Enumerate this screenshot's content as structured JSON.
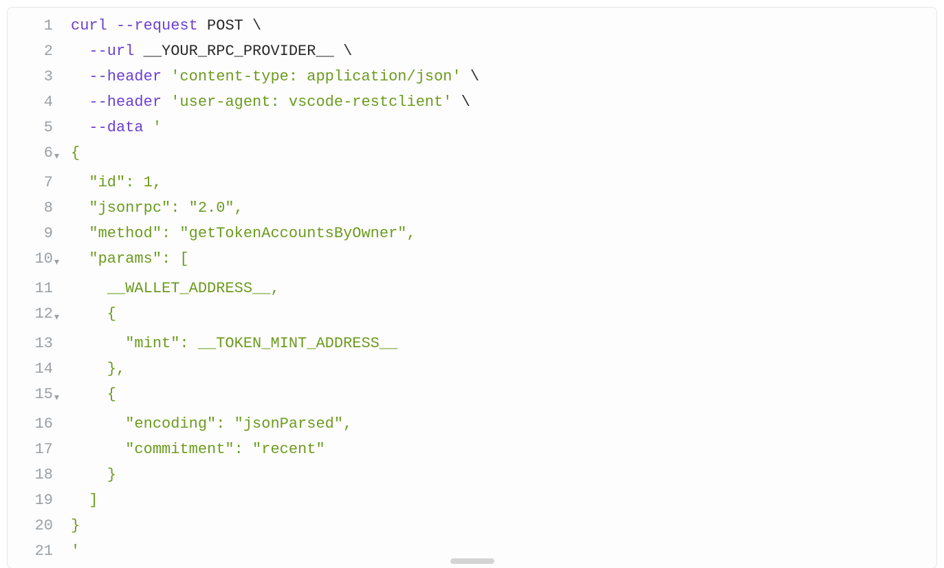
{
  "lines": [
    {
      "n": 1,
      "fold": false,
      "tokens": [
        {
          "cls": "tok-cmd",
          "t": "curl"
        },
        {
          "cls": "tok-plain",
          "t": " "
        },
        {
          "cls": "tok-cmd",
          "t": "--request"
        },
        {
          "cls": "tok-plain",
          "t": " POST \\"
        }
      ]
    },
    {
      "n": 2,
      "fold": false,
      "tokens": [
        {
          "cls": "tok-plain",
          "t": "  "
        },
        {
          "cls": "tok-cmd",
          "t": "--url"
        },
        {
          "cls": "tok-plain",
          "t": " __YOUR_RPC_PROVIDER__ \\"
        }
      ]
    },
    {
      "n": 3,
      "fold": false,
      "tokens": [
        {
          "cls": "tok-plain",
          "t": "  "
        },
        {
          "cls": "tok-cmd",
          "t": "--header"
        },
        {
          "cls": "tok-plain",
          "t": " "
        },
        {
          "cls": "tok-str",
          "t": "'content-type: application/json'"
        },
        {
          "cls": "tok-plain",
          "t": " \\"
        }
      ]
    },
    {
      "n": 4,
      "fold": false,
      "tokens": [
        {
          "cls": "tok-plain",
          "t": "  "
        },
        {
          "cls": "tok-cmd",
          "t": "--header"
        },
        {
          "cls": "tok-plain",
          "t": " "
        },
        {
          "cls": "tok-str",
          "t": "'user-agent: vscode-restclient'"
        },
        {
          "cls": "tok-plain",
          "t": " \\"
        }
      ]
    },
    {
      "n": 5,
      "fold": false,
      "tokens": [
        {
          "cls": "tok-plain",
          "t": "  "
        },
        {
          "cls": "tok-cmd",
          "t": "--data"
        },
        {
          "cls": "tok-plain",
          "t": " "
        },
        {
          "cls": "tok-str",
          "t": "'"
        }
      ]
    },
    {
      "n": 6,
      "fold": true,
      "tokens": [
        {
          "cls": "tok-str",
          "t": "{"
        }
      ]
    },
    {
      "n": 7,
      "fold": false,
      "tokens": [
        {
          "cls": "tok-str",
          "t": "  \"id\": "
        },
        {
          "cls": "tok-num",
          "t": "1"
        },
        {
          "cls": "tok-str",
          "t": ","
        }
      ]
    },
    {
      "n": 8,
      "fold": false,
      "tokens": [
        {
          "cls": "tok-str",
          "t": "  \"jsonrpc\": \"2.0\","
        }
      ]
    },
    {
      "n": 9,
      "fold": false,
      "tokens": [
        {
          "cls": "tok-str",
          "t": "  \"method\": \"getTokenAccountsByOwner\","
        }
      ]
    },
    {
      "n": 10,
      "fold": true,
      "tokens": [
        {
          "cls": "tok-str",
          "t": "  \"params\": ["
        }
      ]
    },
    {
      "n": 11,
      "fold": false,
      "tokens": [
        {
          "cls": "tok-str",
          "t": "    __WALLET_ADDRESS__,"
        }
      ]
    },
    {
      "n": 12,
      "fold": true,
      "tokens": [
        {
          "cls": "tok-str",
          "t": "    {"
        }
      ]
    },
    {
      "n": 13,
      "fold": false,
      "tokens": [
        {
          "cls": "tok-str",
          "t": "      \"mint\": __TOKEN_MINT_ADDRESS__"
        }
      ]
    },
    {
      "n": 14,
      "fold": false,
      "tokens": [
        {
          "cls": "tok-str",
          "t": "    },"
        }
      ]
    },
    {
      "n": 15,
      "fold": true,
      "tokens": [
        {
          "cls": "tok-str",
          "t": "    {"
        }
      ]
    },
    {
      "n": 16,
      "fold": false,
      "tokens": [
        {
          "cls": "tok-str",
          "t": "      \"encoding\": \"jsonParsed\","
        }
      ]
    },
    {
      "n": 17,
      "fold": false,
      "tokens": [
        {
          "cls": "tok-str",
          "t": "      \"commitment\": \"recent\""
        }
      ]
    },
    {
      "n": 18,
      "fold": false,
      "tokens": [
        {
          "cls": "tok-str",
          "t": "    }"
        }
      ]
    },
    {
      "n": 19,
      "fold": false,
      "tokens": [
        {
          "cls": "tok-str",
          "t": "  ]"
        }
      ]
    },
    {
      "n": 20,
      "fold": false,
      "tokens": [
        {
          "cls": "tok-str",
          "t": "}"
        }
      ]
    },
    {
      "n": 21,
      "fold": false,
      "tokens": [
        {
          "cls": "tok-str",
          "t": "'"
        }
      ]
    }
  ]
}
